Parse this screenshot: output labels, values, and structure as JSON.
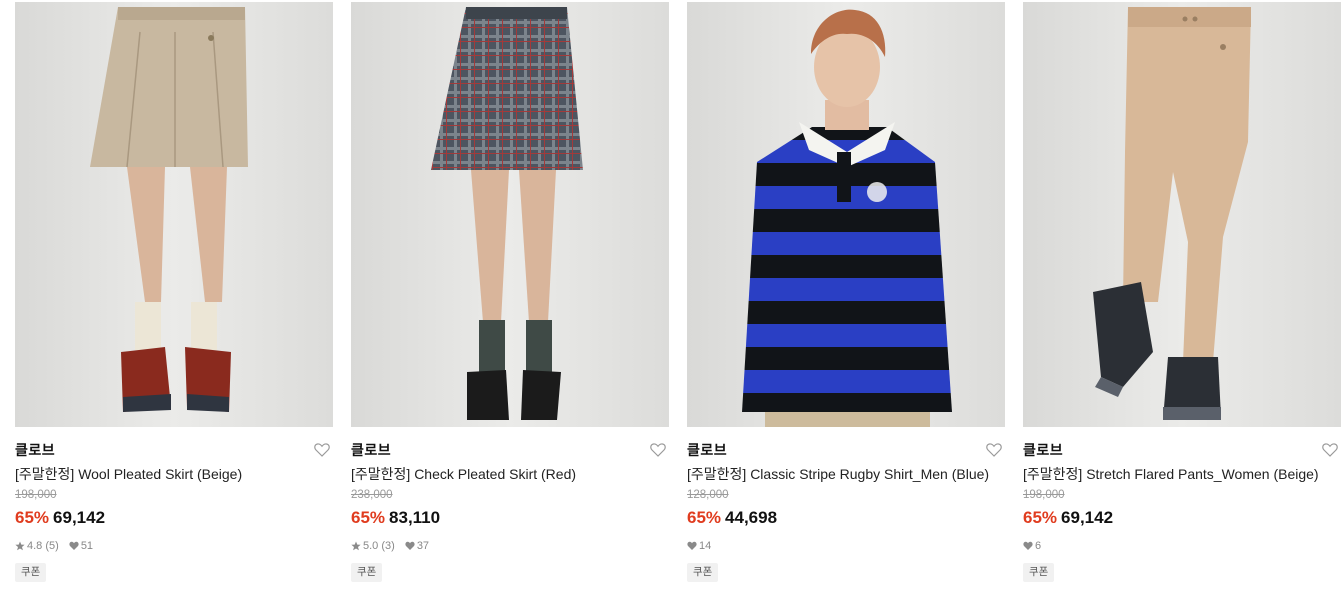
{
  "products": [
    {
      "brand": "클로브",
      "title": "[주말한정] Wool Pleated Skirt (Beige)",
      "original_price": "198,000",
      "discount": "65%",
      "price": "69,142",
      "rating": "4.8",
      "review_count": "(5)",
      "likes": "51",
      "coupon": "쿠폰",
      "image": "woman-in-beige-pleated-skirt-with-red-sneakers"
    },
    {
      "brand": "클로브",
      "title": "[주말한정] Check Pleated Skirt (Red)",
      "original_price": "238,000",
      "discount": "65%",
      "price": "83,110",
      "rating": "5.0",
      "review_count": "(3)",
      "likes": "37",
      "coupon": "쿠폰",
      "image": "woman-in-plaid-pleated-skirt-with-black-loafers"
    },
    {
      "brand": "클로브",
      "title": "[주말한정] Classic Stripe Rugby Shirt_Men (Blue)",
      "original_price": "128,000",
      "discount": "65%",
      "price": "44,698",
      "rating": null,
      "review_count": null,
      "likes": "14",
      "coupon": "쿠폰",
      "image": "man-in-blue-black-striped-rugby-shirt"
    },
    {
      "brand": "클로브",
      "title": "[주말한정] Stretch Flared Pants_Women (Beige)",
      "original_price": "198,000",
      "discount": "65%",
      "price": "69,142",
      "rating": null,
      "review_count": null,
      "likes": "6",
      "coupon": "쿠폰",
      "image": "woman-in-beige-flared-pants-with-black-sneakers"
    }
  ],
  "colors": {
    "discount": "#e03c1f",
    "strike_price": "#9a9a9a",
    "meta": "#888888",
    "coupon_bg": "#f1f1f1"
  },
  "icons": {
    "wishlist": "heart-outline-icon",
    "rating": "star-icon",
    "likes": "heart-filled-icon"
  }
}
